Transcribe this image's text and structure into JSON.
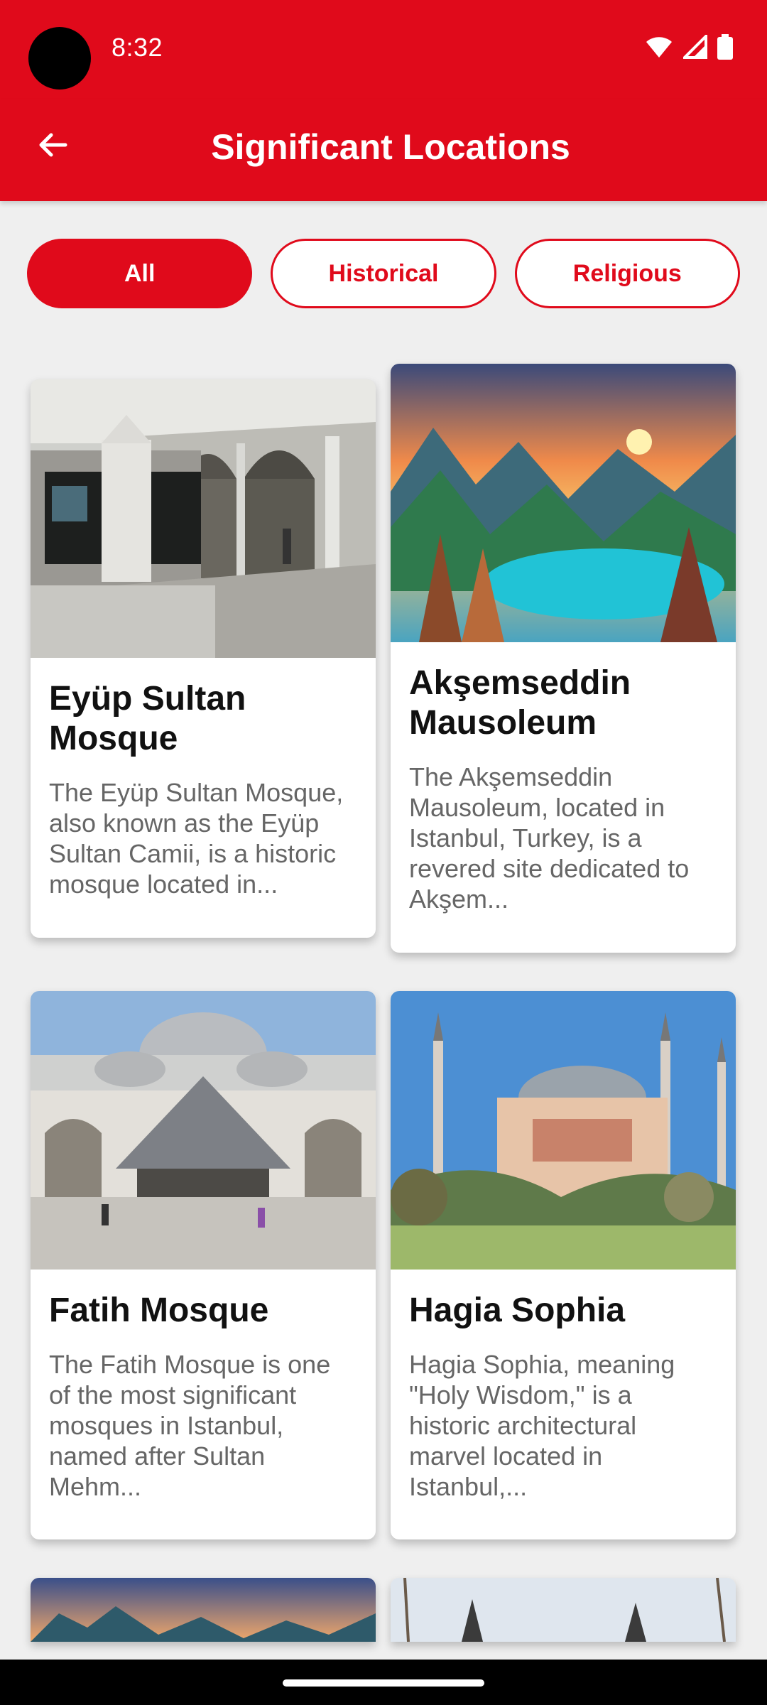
{
  "status_bar": {
    "time": "8:32"
  },
  "app_bar": {
    "title": "Significant Locations"
  },
  "filters": [
    {
      "label": "All",
      "active": true
    },
    {
      "label": "Historical",
      "active": false
    },
    {
      "label": "Religious",
      "active": false
    }
  ],
  "cards": [
    {
      "title": "Eyüp Sultan Mosque",
      "description": "The Eyüp Sultan Mosque, also known as the Eyüp Sultan Camii, is a historic mosque located in..."
    },
    {
      "title": "Akşemseddin Mausoleum",
      "description": "The Akşemseddin Mausoleum, located in Istanbul, Turkey, is a revered site dedicated to Akşem..."
    },
    {
      "title": "Fatih Mosque",
      "description": "The Fatih Mosque is one of the most significant mosques in Istanbul, named after Sultan Mehm..."
    },
    {
      "title": "Hagia Sophia",
      "description": "Hagia Sophia, meaning \"Holy Wisdom,\" is a historic architectural marvel located in Istanbul,..."
    }
  ],
  "colors": {
    "primary": "#e00a1b",
    "background": "#efefef"
  },
  "icons": {
    "back": "arrow-left-icon",
    "wifi": "wifi-icon",
    "signal": "signal-icon",
    "battery": "battery-icon"
  }
}
